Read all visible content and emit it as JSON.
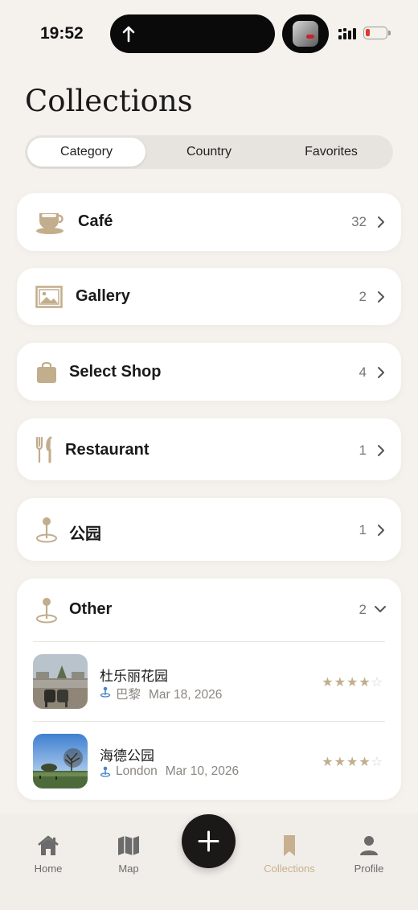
{
  "status_bar": {
    "time": "19:52"
  },
  "header": {
    "title": "Collections"
  },
  "segments": [
    {
      "label": "Category",
      "active": true
    },
    {
      "label": "Country",
      "active": false
    },
    {
      "label": "Favorites",
      "active": false
    }
  ],
  "categories": [
    {
      "label": "Café",
      "count": "32",
      "icon": "coffee-cup-icon"
    },
    {
      "label": "Gallery",
      "count": "2",
      "icon": "picture-frame-icon"
    },
    {
      "label": "Select Shop",
      "count": "4",
      "icon": "shopping-bag-icon"
    },
    {
      "label": "Restaurant",
      "count": "1",
      "icon": "fork-knife-icon"
    },
    {
      "label": "公园",
      "count": "1",
      "icon": "map-pin-icon"
    },
    {
      "label": "Other",
      "count": "2",
      "icon": "map-pin-icon",
      "expanded": true
    }
  ],
  "other_items": [
    {
      "title": "杜乐丽花园",
      "city": "巴黎",
      "date": "Mar 18, 2026",
      "rating": 4,
      "max_rating": 5
    },
    {
      "title": "海德公园",
      "city": "London",
      "date": "Mar 10, 2026",
      "rating": 4,
      "max_rating": 5
    }
  ],
  "tabbar": {
    "home": "Home",
    "map": "Map",
    "collections": "Collections",
    "profile": "Profile",
    "active": "Collections"
  },
  "colors": {
    "accent": "#c2ad8c",
    "background": "#f5f2ed",
    "fab": "#1b1917"
  }
}
